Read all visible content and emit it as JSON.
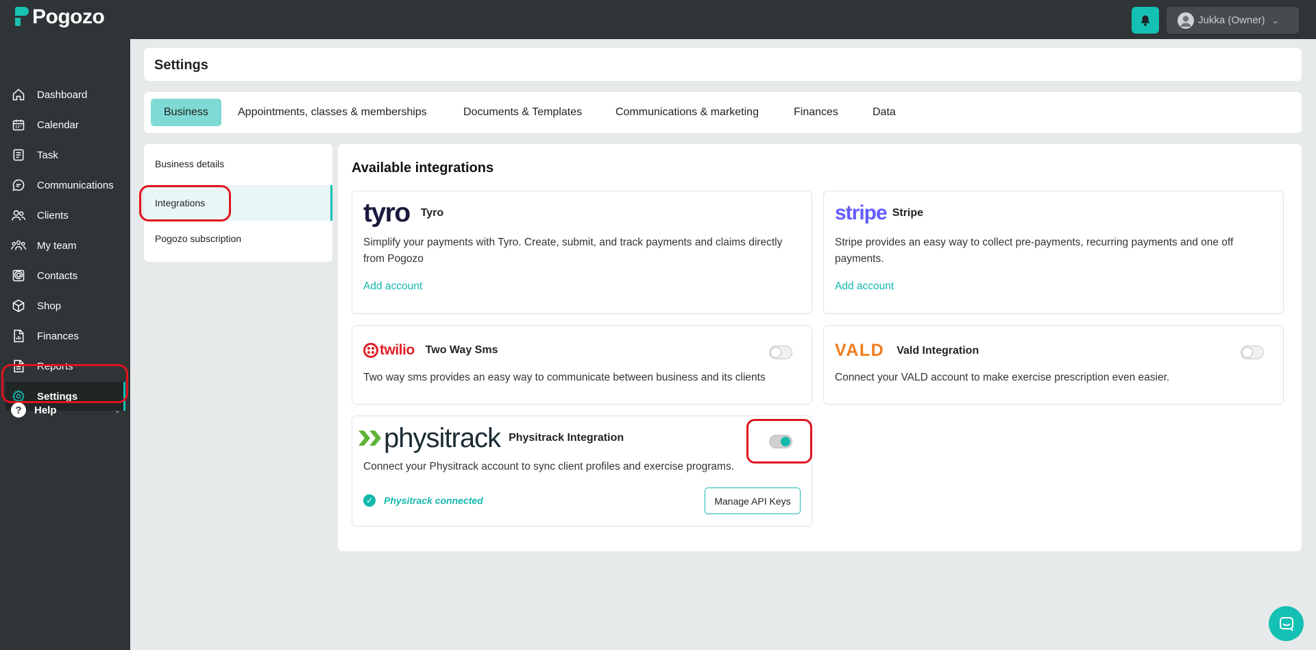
{
  "app": {
    "logo_text": "Pogozo",
    "accent_color": "#14c0b3",
    "user_label": "Jukka (Owner)"
  },
  "sidebar": {
    "items": [
      {
        "label": "Dashboard",
        "icon": "home-icon"
      },
      {
        "label": "Calendar",
        "icon": "calendar-icon"
      },
      {
        "label": "Task",
        "icon": "task-icon"
      },
      {
        "label": "Communications",
        "icon": "chat-icon"
      },
      {
        "label": "Clients",
        "icon": "users-icon"
      },
      {
        "label": "My team",
        "icon": "team-icon"
      },
      {
        "label": "Contacts",
        "icon": "contacts-icon"
      },
      {
        "label": "Shop",
        "icon": "box-icon"
      },
      {
        "label": "Finances",
        "icon": "finance-doc-icon"
      },
      {
        "label": "Reports",
        "icon": "report-icon"
      },
      {
        "label": "Settings",
        "icon": "gear-icon"
      }
    ],
    "help_label": "Help"
  },
  "page": {
    "title": "Settings"
  },
  "tabs": [
    {
      "label": "Business"
    },
    {
      "label": "Appointments, classes & memberships"
    },
    {
      "label": "Documents & Templates"
    },
    {
      "label": "Communications & marketing"
    },
    {
      "label": "Finances"
    },
    {
      "label": "Data"
    }
  ],
  "subnav": [
    {
      "label": "Business details"
    },
    {
      "label": "Integrations"
    },
    {
      "label": "Pogozo subscription"
    }
  ],
  "integrations": {
    "title": "Available integrations",
    "tyro": {
      "logo": "tyro",
      "name": "Tyro",
      "description": "Simplify your payments with Tyro. Create, submit, and track payments and claims directly from Pogozo",
      "action": "Add account"
    },
    "stripe": {
      "logo": "stripe",
      "name": "Stripe",
      "description": "Stripe provides an easy way to collect pre-payments, recurring payments and one off payments.",
      "action": "Add account"
    },
    "twilio": {
      "logo": "twilio",
      "name": "Two Way Sms",
      "description": "Two way sms provides an easy way to communicate between business and its clients",
      "enabled": false
    },
    "vald": {
      "logo": "VALD",
      "name": "Vald Integration",
      "description": "Connect your VALD account to make exercise prescription even easier.",
      "enabled": false
    },
    "physitrack": {
      "logo": "physitrack",
      "name": "Physitrack Integration",
      "description": "Connect your Physitrack account to sync client profiles and exercise programs.",
      "enabled": true,
      "status": "Physitrack connected",
      "button": "Manage API Keys"
    }
  }
}
